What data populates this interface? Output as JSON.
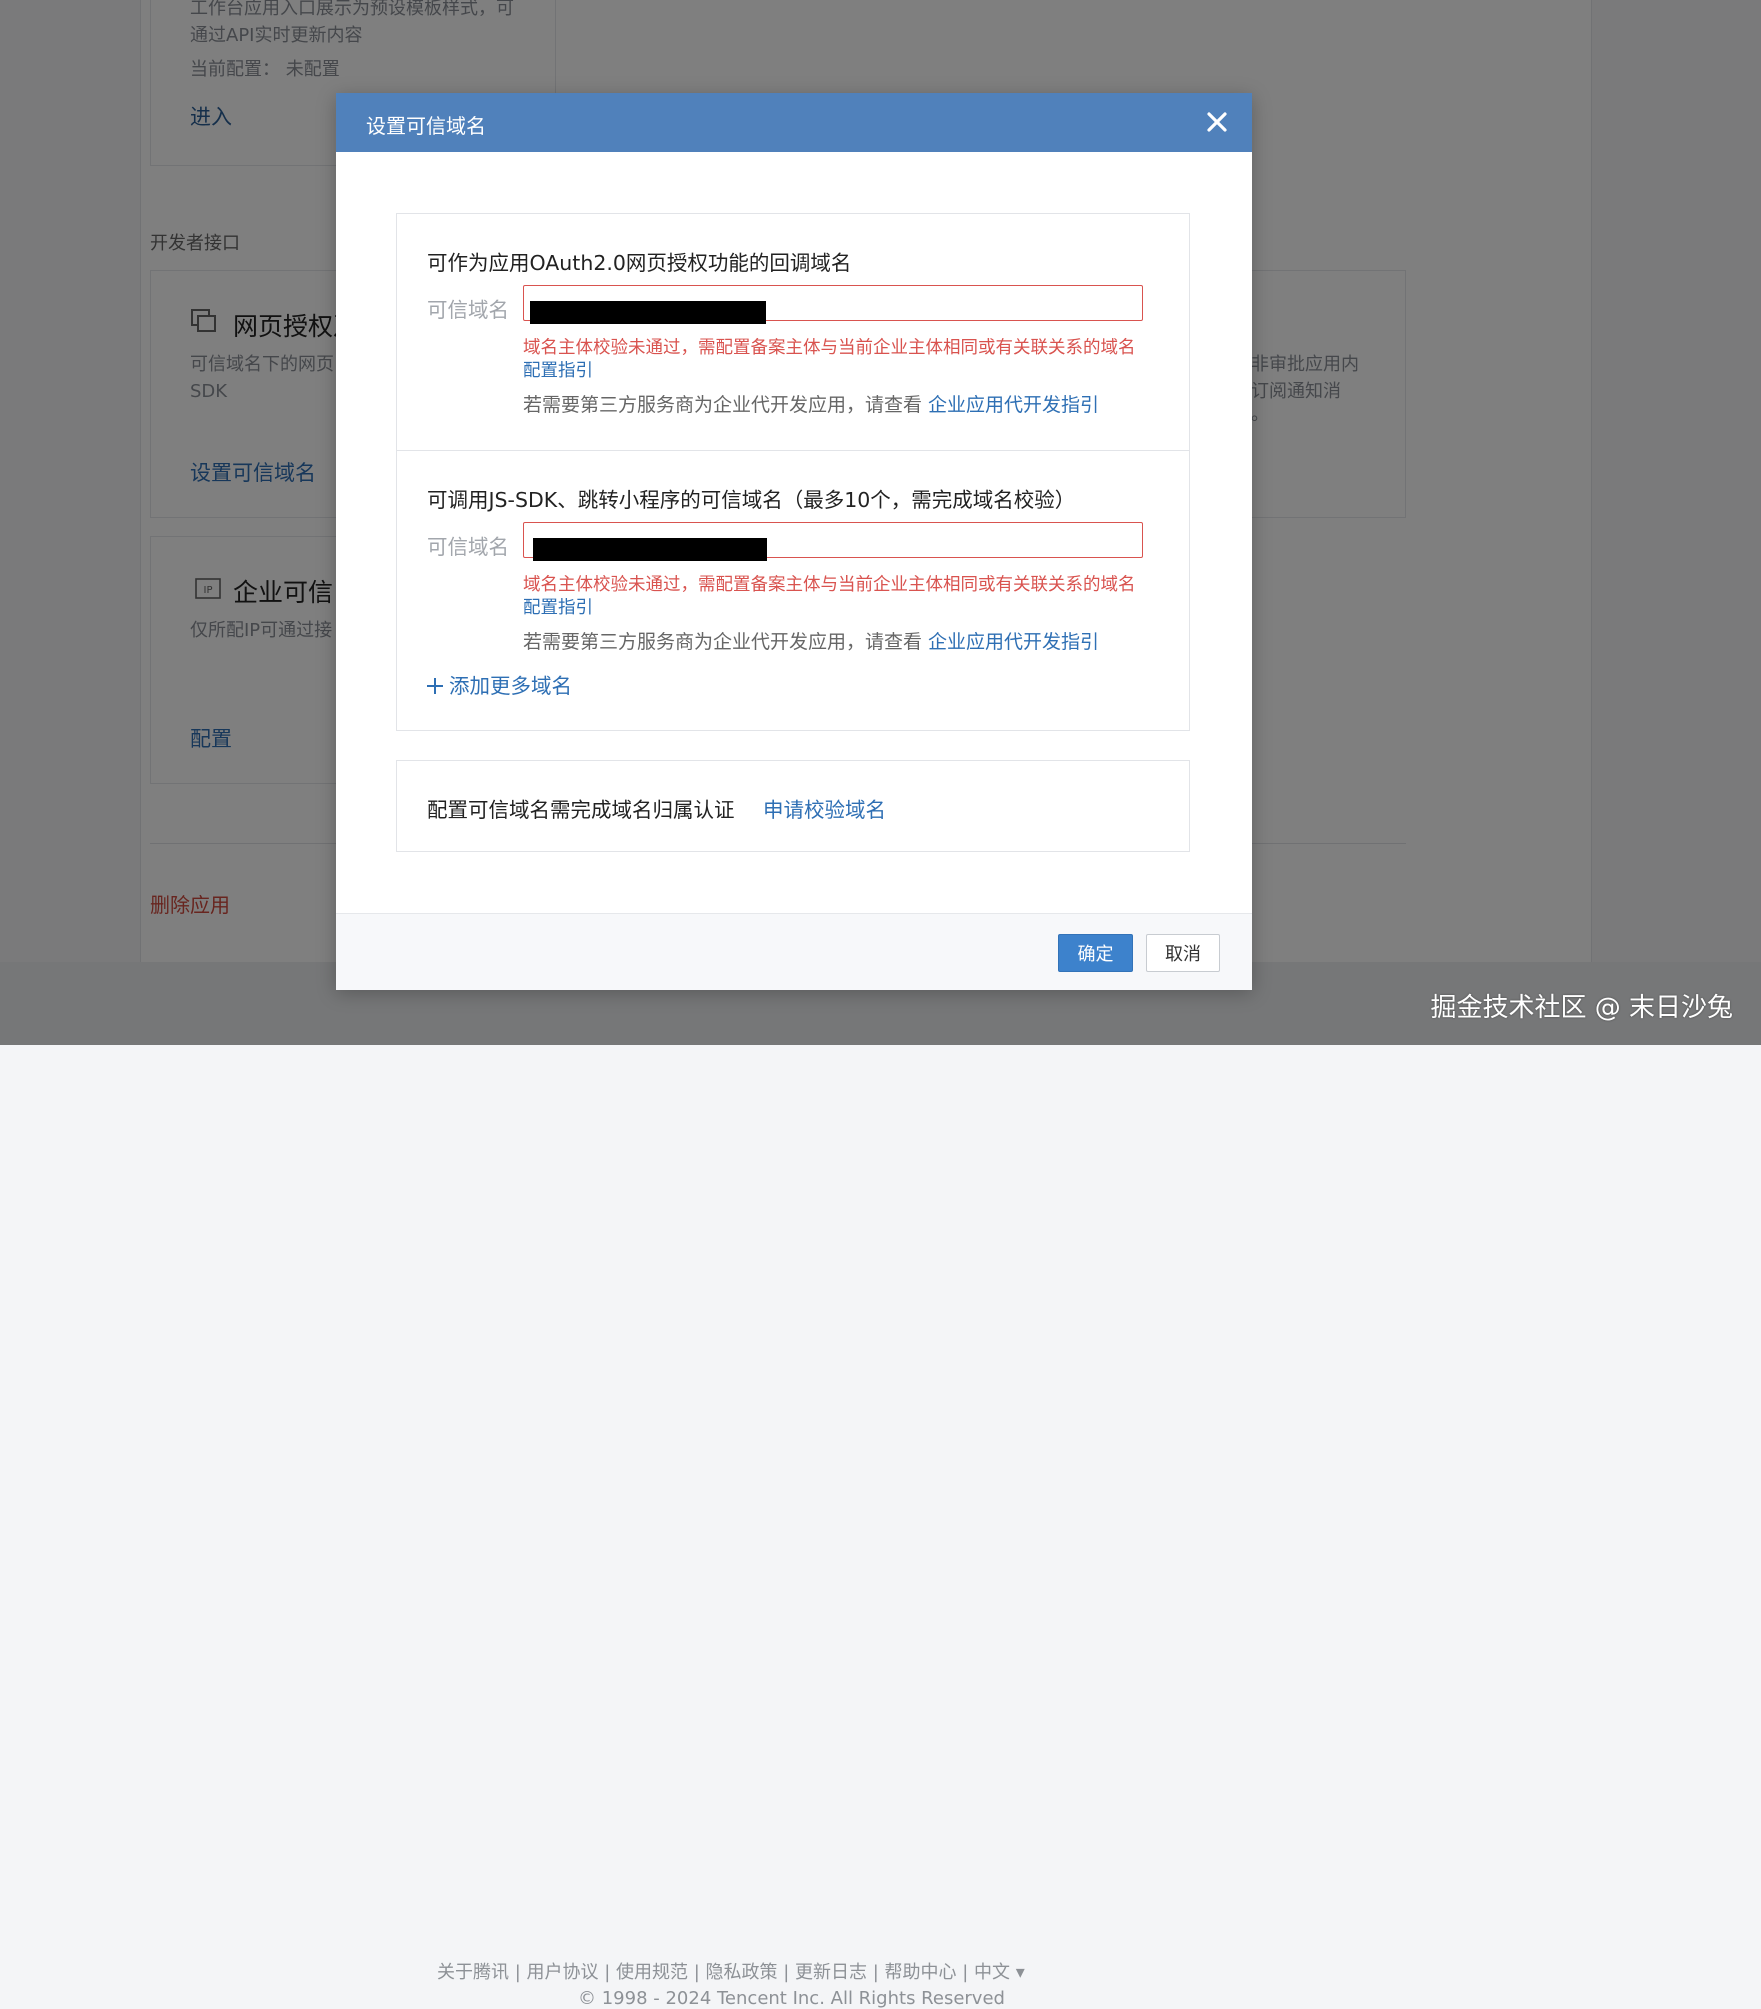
{
  "background": {
    "card_top": {
      "desc_line1": "工作台应用入口展示为预设模板样式，可",
      "desc_line2": "通过API实时更新内容",
      "current_config": "当前配置：  未配置",
      "enter_link": "进入"
    },
    "section_label": "开发者接口",
    "card_oauth": {
      "title": "网页授权及",
      "desc_line1": "可信域名下的网页",
      "desc_line2": "SDK",
      "link": "设置可信域名"
    },
    "card_right": {
      "line1": "非审批应用内",
      "line2": "订阅通知消",
      "line3": "。"
    },
    "card_ip": {
      "title": "企业可信",
      "desc": "仅所配IP可通过接",
      "link": "配置"
    },
    "delete_app": "删除应用",
    "footer": {
      "links": "关于腾讯  |   用户协议   |   使用规范   |   隐私政策   |   更新日志   |   帮助中心    |   中文  ▾",
      "copyright": "© 1998 - 2024 Tencent Inc. All Rights Reserved"
    },
    "watermark": "掘金技术社区 @ 末日沙兔"
  },
  "dialog": {
    "title": "设置可信域名",
    "section1": {
      "title": "可作为应用OAuth2.0网页授权功能的回调域名",
      "label": "可信域名",
      "error": "域名主体校验未通过，需配置备案主体与当前企业主体相同或有关联关系的域名",
      "guide": "配置指引",
      "hint": "若需要第三方服务商为企业代开发应用，请查看 ",
      "hint_link": "企业应用代开发指引"
    },
    "section2": {
      "title": "可调用JS-SDK、跳转小程序的可信域名（最多10个，需完成域名校验）",
      "label": "可信域名",
      "error": "域名主体校验未通过，需配置备案主体与当前企业主体相同或有关联关系的域名",
      "guide": "配置指引",
      "hint": "若需要第三方服务商为企业代开发应用，请查看 ",
      "hint_link": "企业应用代开发指引",
      "add_more": "添加更多域名"
    },
    "verify": {
      "text": "配置可信域名需完成域名归属认证",
      "link": "申请校验域名"
    },
    "confirm": "确定",
    "cancel": "取消"
  }
}
